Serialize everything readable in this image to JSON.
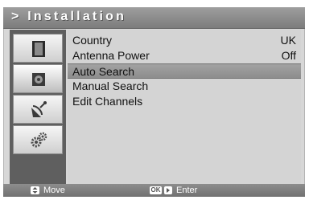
{
  "header": {
    "title": "> Installation"
  },
  "sidebar": {
    "items": [
      {
        "icon": "tv-icon"
      },
      {
        "icon": "speaker-icon"
      },
      {
        "icon": "satellite-dish-icon"
      },
      {
        "icon": "gears-icon"
      }
    ]
  },
  "menu": {
    "items": [
      {
        "label": "Country",
        "value": "UK"
      },
      {
        "label": "Antenna Power",
        "value": "Off"
      },
      {
        "label": "Auto Search",
        "value": ""
      },
      {
        "label": "Manual Search",
        "value": ""
      },
      {
        "label": "Edit Channels",
        "value": ""
      }
    ],
    "selected_index": 2
  },
  "footer": {
    "move_label": "Move",
    "ok_key": "OK",
    "enter_label": "Enter"
  },
  "colors": {
    "selection_bg": "#959595",
    "titlebar": "#8a8a8a",
    "sidebar_bg": "#5f5f5f"
  }
}
